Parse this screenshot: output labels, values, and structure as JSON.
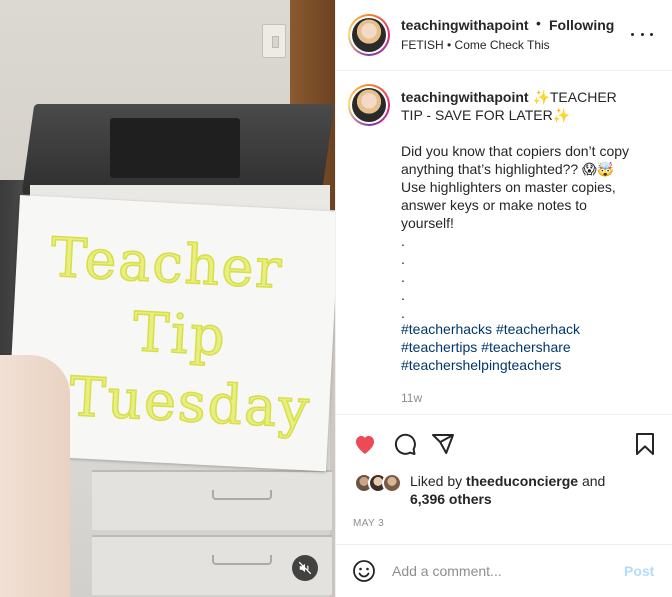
{
  "post": {
    "username": "teachingwithapoint",
    "follow_label": "Following",
    "separator": "•",
    "audio": "FETISH • Come Check This",
    "more_icon": "more-horizontal-icon"
  },
  "media": {
    "sign_lines": [
      "Teacher",
      "Tip",
      "Tuesday"
    ],
    "mute_icon": "muted-speaker-icon"
  },
  "caption": {
    "username": "teachingwithapoint",
    "text_part1": " ✨TEACHER TIP - SAVE FOR LATER✨",
    "text_part2": "Did you know that copiers don’t copy anything that’s highlighted?? 😱🤯 Use highlighters on master copies, answer keys or make notes to yourself!\n.\n.\n.\n.\n.",
    "hashtags": [
      "#teacherhacks",
      "#teacherhack",
      "#teachertips",
      "#teachershare",
      "#teachershelpingteachers"
    ],
    "time_ago": "11w"
  },
  "actions": {
    "like_icon": "heart-filled-icon",
    "like_color": "#ed4956",
    "comment_icon": "comment-icon",
    "share_icon": "share-icon",
    "save_icon": "bookmark-icon"
  },
  "likes": {
    "prefix": "Liked by ",
    "liked_by_user": "theeduconcierge",
    "conj": " and",
    "others": "6,396 others"
  },
  "date": "MAY 3",
  "comment": {
    "emoji_icon": "emoji-smile-icon",
    "placeholder": "Add a comment...",
    "post_label": "Post",
    "post_color": "#b3dbff"
  }
}
